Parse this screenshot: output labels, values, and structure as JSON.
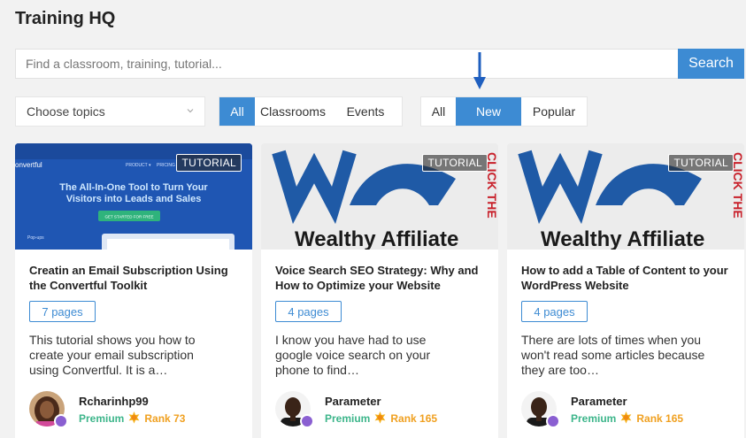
{
  "page": {
    "title": "Training HQ"
  },
  "search": {
    "placeholder": "Find a classroom, training, tutorial...",
    "button": "Search"
  },
  "filters": {
    "topics_placeholder": "Choose topics",
    "type_options": [
      "All",
      "Classrooms",
      "Events"
    ],
    "type_selected": "All",
    "sort_options": [
      "All",
      "New",
      "Popular"
    ],
    "sort_selected": "New"
  },
  "cards": [
    {
      "badge": "TUTORIAL",
      "thumb": {
        "brand": "onvertful",
        "headline": "The All-In-One Tool to Turn Your Visitors into Leads and Sales",
        "cta": "GET STARTED FOR FREE",
        "nav_product": "PRODUCT ▾",
        "nav_pricing": "PRICING",
        "corner": "Pop-ups"
      },
      "title": "Creatin an Email Subscription Using the Convertful Toolkit",
      "pages": "7 pages",
      "description": "This tutorial shows you how to create your email subscription using Convertful. It is a…",
      "author": "Rcharinhp99",
      "membership": "Premium",
      "rank": "Rank 73"
    },
    {
      "badge": "TUTORIAL",
      "thumb": {
        "logo_text": "Wealthy Affiliate",
        "side_text": "CLICK THE"
      },
      "title": "Voice Search SEO Strategy: Why and How to Optimize your Website",
      "pages": "4 pages",
      "description": "I know you have had to use google voice search on your phone to find…",
      "author": "Parameter",
      "membership": "Premium",
      "rank": "Rank 165"
    },
    {
      "badge": "TUTORIAL",
      "thumb": {
        "logo_text": "Wealthy Affiliate",
        "side_text": "CLICK THE"
      },
      "title": "How to add a Table of Content to your WordPress Website",
      "pages": "4 pages",
      "description": "There are lots of times when you won't read some articles because they are too…",
      "author": "Parameter",
      "membership": "Premium",
      "rank": "Rank 165"
    }
  ],
  "colors": {
    "accent": "#3d8bd3",
    "premium": "#3cb58a",
    "rank": "#f0a020",
    "background": "#f2f2f2"
  },
  "icons": {
    "annotation_arrow": "arrow-down-icon",
    "topics_chevron": "chevron-down-icon",
    "rank_badge": "sun-badge-icon",
    "membership": "heart-badge-icon"
  }
}
